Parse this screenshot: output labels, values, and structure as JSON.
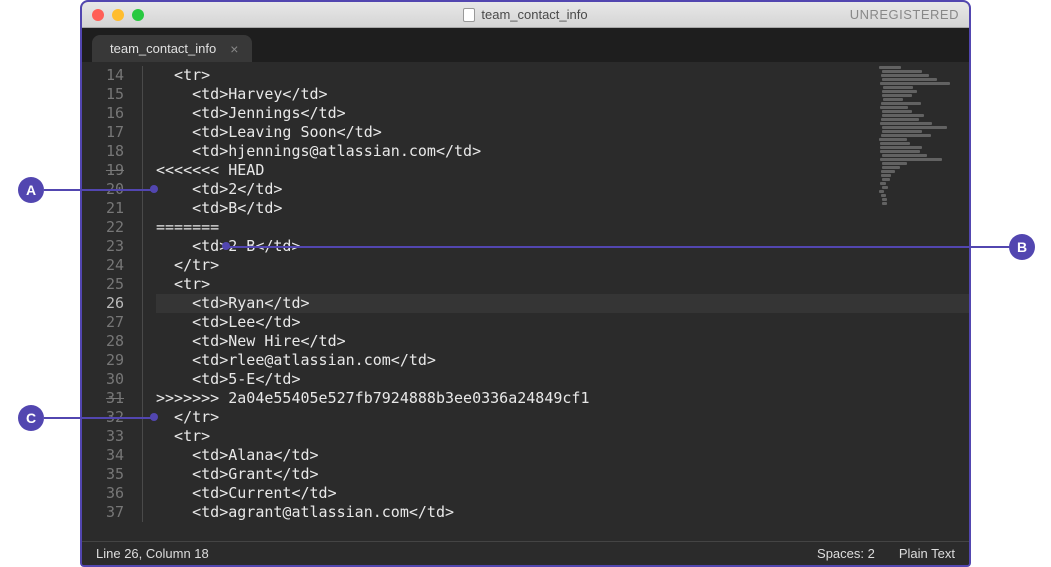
{
  "titlebar": {
    "filename": "team_contact_info",
    "unregistered_label": "UNREGISTERED"
  },
  "tab": {
    "label": "team_contact_info"
  },
  "lines": [
    {
      "n": 14,
      "text": "  <tr>"
    },
    {
      "n": 15,
      "text": "    <td>Harvey</td>"
    },
    {
      "n": 16,
      "text": "    <td>Jennings</td>"
    },
    {
      "n": 17,
      "text": "    <td>Leaving Soon</td>"
    },
    {
      "n": 18,
      "text": "    <td>hjennings@atlassian.com</td>"
    },
    {
      "n": 19,
      "text": "<<<<<<< HEAD",
      "struck": true,
      "callout": "A"
    },
    {
      "n": 20,
      "text": "    <td>2</td>"
    },
    {
      "n": 21,
      "text": "    <td>B</td>"
    },
    {
      "n": 22,
      "text": "=======",
      "callout": "B"
    },
    {
      "n": 23,
      "text": "    <td>2-B</td>"
    },
    {
      "n": 24,
      "text": "  </tr>"
    },
    {
      "n": 25,
      "text": "  <tr>"
    },
    {
      "n": 26,
      "text": "    <td>Ryan</td>",
      "active": true
    },
    {
      "n": 27,
      "text": "    <td>Lee</td>"
    },
    {
      "n": 28,
      "text": "    <td>New Hire</td>"
    },
    {
      "n": 29,
      "text": "    <td>rlee@atlassian.com</td>"
    },
    {
      "n": 30,
      "text": "    <td>5-E</td>"
    },
    {
      "n": 31,
      "text": ">>>>>>> 2a04e55405e527fb7924888b3ee0336a24849cf1",
      "struck": true,
      "callout": "C"
    },
    {
      "n": 32,
      "text": "  </tr>"
    },
    {
      "n": 33,
      "text": "  <tr>"
    },
    {
      "n": 34,
      "text": "    <td>Alana</td>"
    },
    {
      "n": 35,
      "text": "    <td>Grant</td>"
    },
    {
      "n": 36,
      "text": "    <td>Current</td>"
    },
    {
      "n": 37,
      "text": "    <td>agrant@atlassian.com</td>"
    }
  ],
  "status": {
    "cursor": "Line 26, Column 18",
    "spaces": "Spaces: 2",
    "syntax": "Plain Text"
  },
  "callouts": {
    "A": "A",
    "B": "B",
    "C": "C"
  },
  "minimap_widths": [
    22,
    40,
    48,
    55,
    70,
    30,
    35,
    30,
    20,
    40,
    28,
    30,
    42,
    38,
    52,
    65,
    40,
    50,
    28,
    30,
    42,
    40,
    45,
    62,
    25,
    18,
    14,
    10,
    8,
    6,
    6,
    5,
    5,
    5,
    5
  ]
}
